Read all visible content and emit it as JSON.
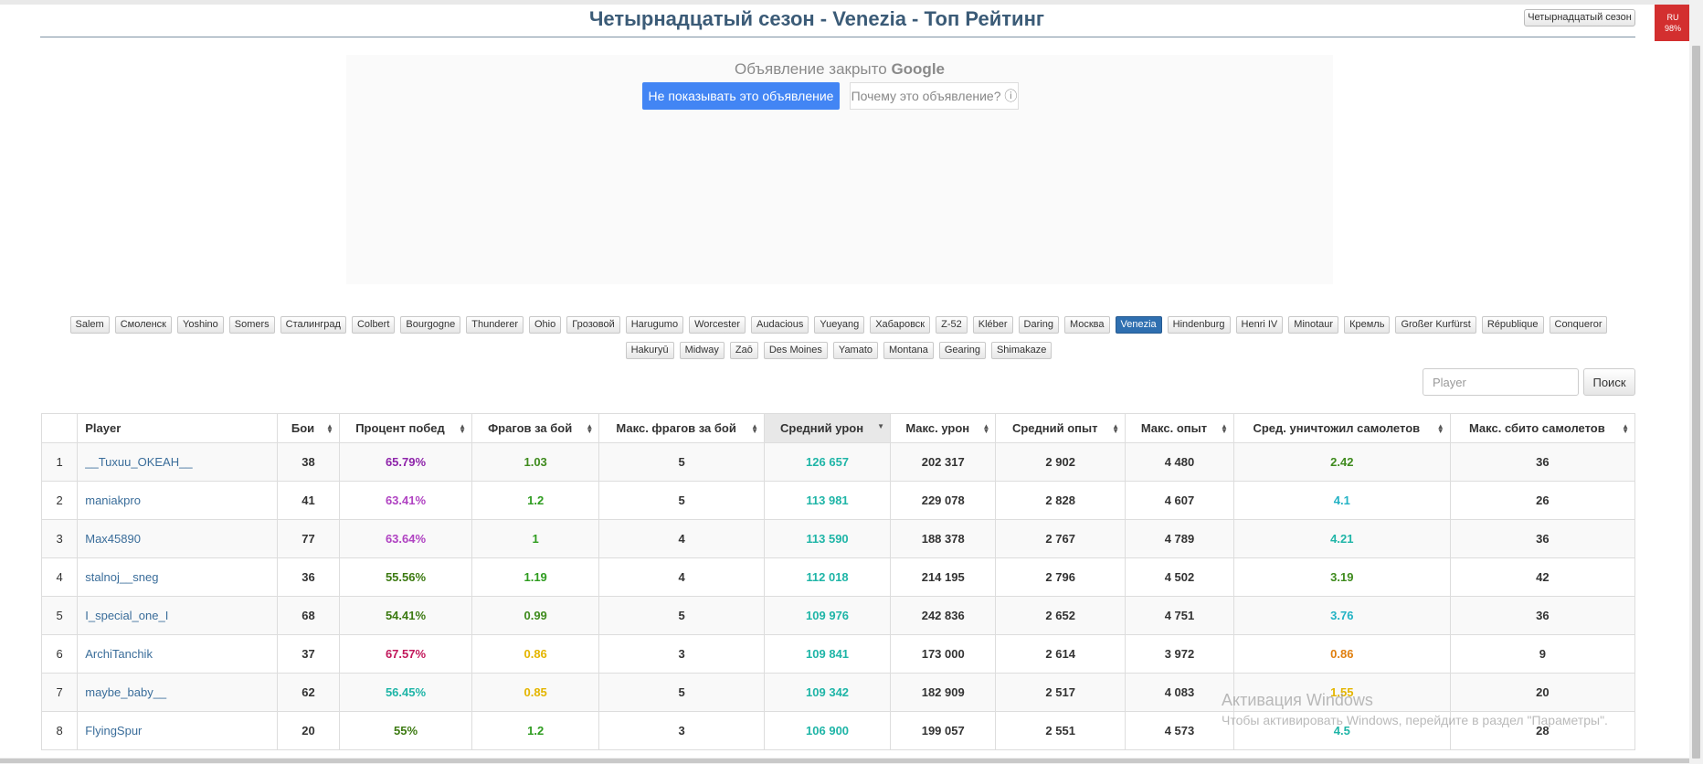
{
  "page": {
    "title": "Четырнадцатый сезон - Venezia - Топ Рейтинг",
    "season_button": "Четырнадцатый сезон"
  },
  "lang_badge": {
    "code": "RU",
    "percent": "98%"
  },
  "ad": {
    "closed_text": "Объявление закрыто",
    "brand": "Google",
    "hide_label": "Не показывать это объявление",
    "why_label": "Почему это объявление? ⓘ"
  },
  "ships": [
    "Salem",
    "Смоленск",
    "Yoshino",
    "Somers",
    "Сталинград",
    "Colbert",
    "Bourgogne",
    "Thunderer",
    "Ohio",
    "Грозовой",
    "Harugumo",
    "Worcester",
    "Audacious",
    "Yueyang",
    "Хабаровск",
    "Z-52",
    "Kléber",
    "Daring",
    "Москва",
    "Venezia",
    "Hindenburg",
    "Henri IV",
    "Minotaur",
    "Кремль",
    "Großer Kurfürst",
    "République",
    "Conqueror",
    "Hakuryū",
    "Midway",
    "Zaō",
    "Des Moines",
    "Yamato",
    "Montana",
    "Gearing",
    "Shimakaze"
  ],
  "active_ship": "Venezia",
  "search": {
    "placeholder": "Player",
    "button": "Поиск"
  },
  "table": {
    "headers": [
      "",
      "Player",
      "Бои",
      "Процент побед",
      "Фрагов за бой",
      "Макс. фрагов за бой",
      "Средний урон",
      "Макс. урон",
      "Средний опыт",
      "Макс. опыт",
      "Сред. уничтожил самолетов",
      "Макс. сбито самолетов"
    ],
    "sorted_column": "Средний урон",
    "rows": [
      {
        "rank": "1",
        "player": "__Tuxuu_OKEAH__",
        "battles": "38",
        "winrate": "65.79%",
        "winrate_color": "purple",
        "frags": "1.03",
        "frags_color": "olive",
        "max_frags": "5",
        "avg_dmg": "126 657",
        "max_dmg": "202 317",
        "avg_xp": "2 902",
        "max_xp": "4 480",
        "avg_planes": "2.42",
        "planes_color": "olive",
        "max_planes": "36"
      },
      {
        "rank": "2",
        "player": "maniakpro",
        "battles": "41",
        "winrate": "63.41%",
        "winrate_color": "violet",
        "frags": "1.2",
        "frags_color": "green",
        "max_frags": "5",
        "avg_dmg": "113 981",
        "max_dmg": "229 078",
        "avg_xp": "2 828",
        "max_xp": "4 607",
        "avg_planes": "4.1",
        "planes_color": "cyan",
        "max_planes": "26"
      },
      {
        "rank": "3",
        "player": "Max45890",
        "battles": "77",
        "winrate": "63.64%",
        "winrate_color": "violet",
        "frags": "1",
        "frags_color": "green",
        "max_frags": "4",
        "avg_dmg": "113 590",
        "max_dmg": "188 378",
        "avg_xp": "2 767",
        "max_xp": "4 789",
        "avg_planes": "4.21",
        "planes_color": "teal",
        "max_planes": "36"
      },
      {
        "rank": "4",
        "player": "stalnoj__sneg",
        "battles": "36",
        "winrate": "55.56%",
        "winrate_color": "darkgreen",
        "frags": "1.19",
        "frags_color": "green",
        "max_frags": "4",
        "avg_dmg": "112 018",
        "max_dmg": "214 195",
        "avg_xp": "2 796",
        "max_xp": "4 502",
        "avg_planes": "3.19",
        "planes_color": "olive",
        "max_planes": "42"
      },
      {
        "rank": "5",
        "player": "I_special_one_I",
        "battles": "68",
        "winrate": "54.41%",
        "winrate_color": "darkgreen",
        "frags": "0.99",
        "frags_color": "olive",
        "max_frags": "5",
        "avg_dmg": "109 976",
        "max_dmg": "242 836",
        "avg_xp": "2 652",
        "max_xp": "4 751",
        "avg_planes": "3.76",
        "planes_color": "cyan",
        "max_planes": "36"
      },
      {
        "rank": "6",
        "player": "ArchiTanchik",
        "battles": "37",
        "winrate": "67.57%",
        "winrate_color": "magenta",
        "frags": "0.86",
        "frags_color": "yellow",
        "max_frags": "3",
        "avg_dmg": "109 841",
        "max_dmg": "173 000",
        "avg_xp": "2 614",
        "max_xp": "3 972",
        "avg_planes": "0.86",
        "planes_color": "orange",
        "max_planes": "9"
      },
      {
        "rank": "7",
        "player": "maybe_baby__",
        "battles": "62",
        "winrate": "56.45%",
        "winrate_color": "teal",
        "frags": "0.85",
        "frags_color": "yellow",
        "max_frags": "5",
        "avg_dmg": "109 342",
        "max_dmg": "182 909",
        "avg_xp": "2 517",
        "max_xp": "4 083",
        "avg_planes": "1.55",
        "planes_color": "yellow",
        "max_planes": "20"
      },
      {
        "rank": "8",
        "player": "FlyingSpur",
        "battles": "20",
        "winrate": "55%",
        "winrate_color": "darkgreen",
        "frags": "1.2",
        "frags_color": "green",
        "max_frags": "3",
        "avg_dmg": "106 900",
        "max_dmg": "199 057",
        "avg_xp": "2 551",
        "max_xp": "4 573",
        "avg_planes": "4.5",
        "planes_color": "teal",
        "max_planes": "28"
      }
    ]
  },
  "watermark": {
    "line1": "Активация Windows",
    "line2": "Чтобы активировать Windows, перейдите в раздел \"Параметры\"."
  }
}
